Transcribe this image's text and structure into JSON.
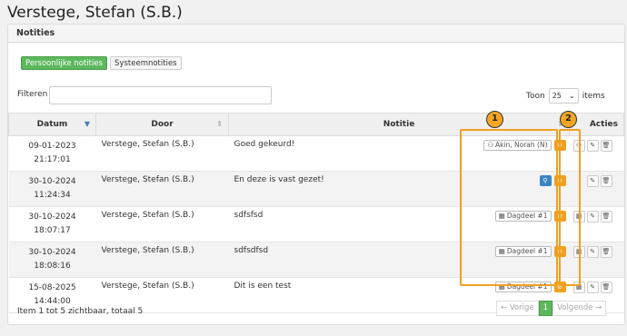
{
  "page": {
    "title": "Verstege, Stefan (S.B.)"
  },
  "panel": {
    "heading": "Notities",
    "tabs": [
      {
        "label": "Persoonlijke notities",
        "active": true
      },
      {
        "label": "Systeemnotities",
        "active": false
      }
    ],
    "filter_label": "Filteren",
    "filter_value": "",
    "show_label": "Toon",
    "show_value": "25",
    "show_suffix": "items"
  },
  "table": {
    "columns": [
      "Datum",
      "Door",
      "Notitie",
      "Acties"
    ],
    "rows": [
      {
        "date": "09-01-2023",
        "time": "21:17:01",
        "door": "Verstege, Stefan (S.B.)",
        "note": "Goed gekeurd!",
        "badge": "Akin, Norah (N)",
        "badge_icon": "person-icon",
        "status": "visibility-off"
      },
      {
        "date": "30-10-2024",
        "time": "11:24:34",
        "door": "Verstege, Stefan (S.B.)",
        "note": "En deze is vast gezet!",
        "badge": "",
        "badge_icon": "",
        "status": "pinned"
      },
      {
        "date": "30-10-2024",
        "time": "18:07:17",
        "door": "Verstege, Stefan (S.B.)",
        "note": "sdfsfsd",
        "badge": "Dagdeel #1",
        "badge_icon": "calendar-icon",
        "status": "visibility-off"
      },
      {
        "date": "30-10-2024",
        "time": "18:08:16",
        "door": "Verstege, Stefan (S.B.)",
        "note": "sdfsdfsd",
        "badge": "Dagdeel #1",
        "badge_icon": "calendar-icon",
        "status": "visibility-off"
      },
      {
        "date": "15-08-2025",
        "time": "14:44:00",
        "door": "Verstege, Stefan (S.B.)",
        "note": "Dit is een test",
        "badge": "Dagdeel #1",
        "badge_icon": "calendar-icon",
        "status": "visibility-off"
      }
    ]
  },
  "footer": {
    "summary": "Item 1 tot 5 zichtbaar, totaal 5",
    "prev": "← Vorige",
    "current_page": "1",
    "next": "Volgende →"
  },
  "annotations": [
    "1",
    "2"
  ],
  "colors": {
    "accent_green": "#5cb85c",
    "highlight_orange": "#f0a020",
    "pin_blue": "#3b84c4"
  }
}
